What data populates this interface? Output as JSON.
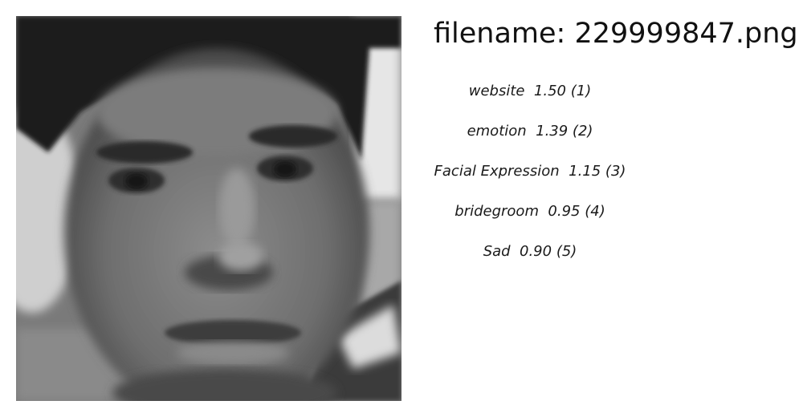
{
  "header": {
    "filename_label": "filename: 229999847.png"
  },
  "photo": {
    "subject": "grayscale-face-photo"
  },
  "labels": [
    {
      "text": "website  1.50 (1)"
    },
    {
      "text": "emotion  1.39 (2)"
    },
    {
      "text": "Facial Expression  1.15 (3)"
    },
    {
      "text": "bridegroom  0.95 (4)"
    },
    {
      "text": "Sad  0.90 (5)"
    }
  ]
}
